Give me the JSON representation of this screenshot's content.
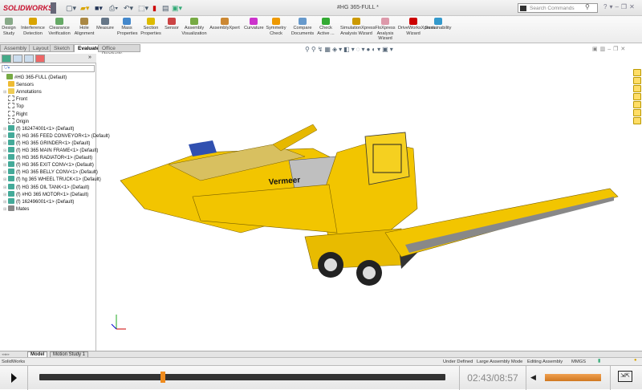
{
  "app": {
    "name": "SOLIDWORKS",
    "document_title": "#HG 365-FULL *",
    "search_placeholder": "Search Commands"
  },
  "ribbon": [
    {
      "label": "Design Study"
    },
    {
      "label": "Interference Detection"
    },
    {
      "label": "Clearance Verification"
    },
    {
      "label": "Hole Alignment"
    },
    {
      "label": "Measure"
    },
    {
      "label": "Mass Properties"
    },
    {
      "label": "Section Properties"
    },
    {
      "label": "Sensor"
    },
    {
      "label": "Assembly Visualization"
    },
    {
      "label": "AssemblyXpert"
    },
    {
      "label": "Curvature"
    },
    {
      "label": "Symmetry Check"
    },
    {
      "label": "Compare Documents"
    },
    {
      "label": "Check Active ..."
    },
    {
      "label": "SimulationXpress Analysis Wizard"
    },
    {
      "label": "FloXpress Analysis Wizard"
    },
    {
      "label": "DriveWorksXpress Wizard"
    },
    {
      "label": "Sustainability"
    }
  ],
  "tabs": [
    "Assembly",
    "Layout",
    "Sketch",
    "Evaluate",
    "Office Products"
  ],
  "active_tab": "Evaluate",
  "tree": [
    "#HG 365-FULL  (Default)",
    "Sensors",
    "Annotations",
    "Front",
    "Top",
    "Right",
    "Origin",
    "(f) 162474001<1> (Default)",
    "(f) HG 365 FEED CONVEYOR<1> (Default)",
    "(f) HG 365 GRINDER<1> (Default)",
    "(f) HG 365 MAIN FRAME<1> (Default)",
    "(f) HG 365 RADIATOR<1> (Default)",
    "(f) HG 365 EXIT CONV<1> (Default)",
    "(f) HG 365 BELLY CONV<1> (Default)",
    "(f) hg 365 WHEEL TRUCK<1> (Default)",
    "(f) HG 365 OIL TANK<1> (Default)",
    "(f) #HG 365 MOTOR<1> (Default)",
    "(f) 162496001<1> (Default)",
    "Mates"
  ],
  "model_branding": "Vermeer",
  "bottom_tabs": [
    "Model",
    "Motion Study 1"
  ],
  "status": {
    "app": "SolidWorks",
    "items": [
      "Under Defined",
      "Large Assembly Mode",
      "Editing Assembly",
      "MMGS"
    ]
  },
  "player": {
    "time": "02:43/08:57",
    "progress": 0.3035,
    "volume": 1.0
  },
  "colors": {
    "accent": "#f08c1e",
    "model_yellow": "#f2c500",
    "brand_red": "#c8102e"
  }
}
